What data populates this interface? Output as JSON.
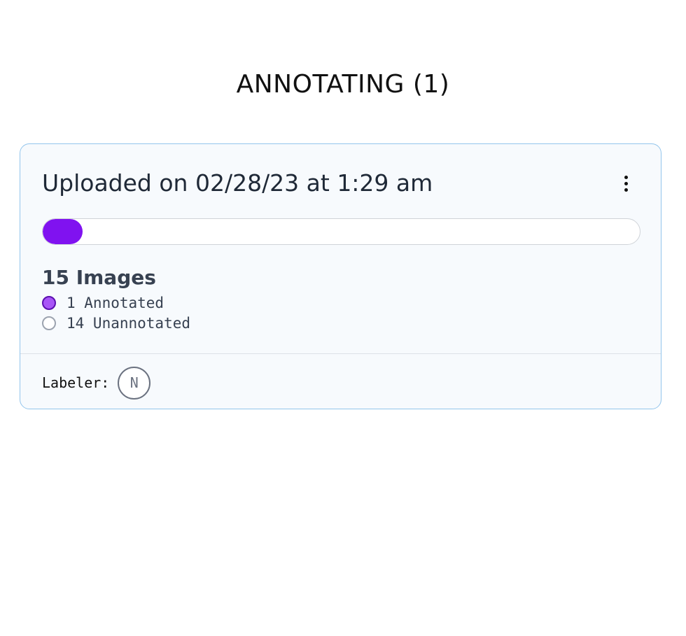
{
  "page": {
    "title": "ANNOTATING (1)"
  },
  "upload_card": {
    "title": "Uploaded on 02/28/23 at 1:29 am",
    "menu_icon": "more-vertical-icon",
    "progress": {
      "annotated": 1,
      "total": 15,
      "fill_color": "#8012f0"
    },
    "images_count": "15 Images",
    "legend": [
      {
        "label": "1 Annotated",
        "status": "annotated",
        "color": "#a855f7"
      },
      {
        "label": "14 Unannotated",
        "status": "unannotated",
        "color": "#9ca3af"
      }
    ],
    "labeler_label": "Labeler:",
    "labeler_avatar_initial": "N"
  },
  "colors": {
    "card_border": "#93c5ec",
    "card_background": "#f7fafd",
    "accent": "#8012f0"
  }
}
